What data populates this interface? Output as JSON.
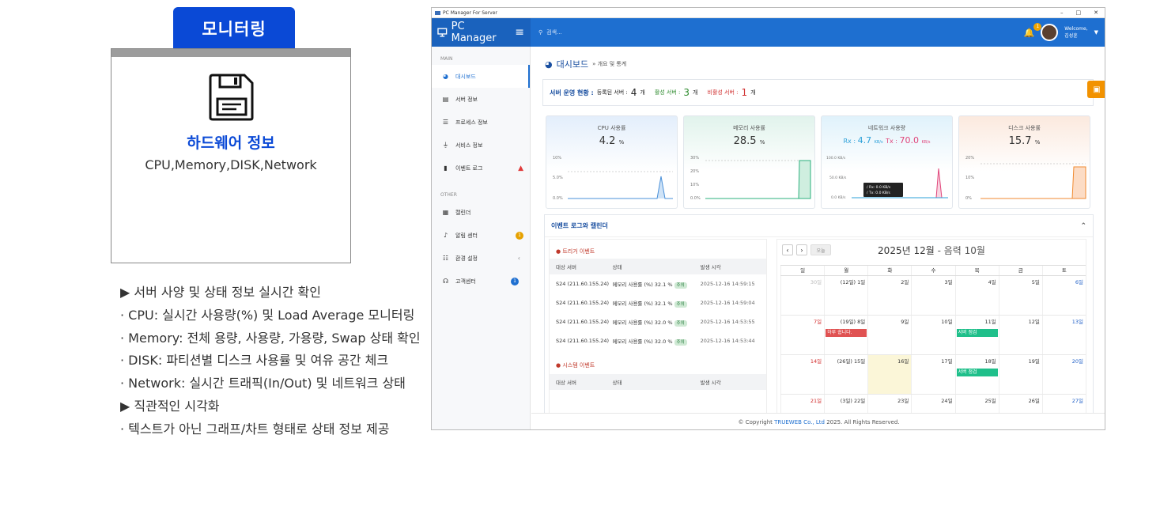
{
  "left": {
    "tab_label": "모니터링",
    "card_title": "하드웨어 정보",
    "card_sub": "CPU,Memory,DISK,Network",
    "desc": [
      "▶ 서버 사양 및 상태 정보 실시간 확인",
      "· CPU: 실시간 사용량(%) 및 Load Average 모니터링",
      "· Memory: 전체 용량, 사용량, 가용량, Swap 상태 확인",
      "· DISK: 파티션별 디스크 사용률 및 여유 공간 체크",
      "· Network: 실시간 트래픽(In/Out) 및 네트워크 상태",
      "▶ 직관적인 시각화",
      "· 텍스트가 아닌 그래프/차트 형태로 상태 정보 제공"
    ]
  },
  "app": {
    "window_title": "PC Manager For Server",
    "brand": "PC Manager",
    "search_placeholder": "검색...",
    "notif_count": "1",
    "welcome": "Welcome,",
    "user": "김성훈",
    "sidebar": {
      "main_label": "MAIN",
      "other_label": "OTHER",
      "main_items": [
        {
          "label": "대시보드",
          "icon": "dashboard-icon"
        },
        {
          "label": "서버 정보",
          "icon": "server-icon"
        },
        {
          "label": "프로세스 정보",
          "icon": "list-icon"
        },
        {
          "label": "서비스 정보",
          "icon": "plug-icon"
        },
        {
          "label": "이벤트 로그",
          "icon": "file-icon"
        }
      ],
      "other_items": [
        {
          "label": "캘린더",
          "icon": "calendar-icon"
        },
        {
          "label": "알림 센터",
          "icon": "bell-icon",
          "badge": "1"
        },
        {
          "label": "환경 설정",
          "icon": "sliders-icon"
        },
        {
          "label": "고객센터",
          "icon": "headset-icon",
          "badge": "1"
        }
      ]
    },
    "breadcrumb": {
      "title": "대시보드",
      "sub": "» 개요 및 통계"
    },
    "status": {
      "title": "서버 운영 현황 :",
      "registered_label": "등록된 서버 :",
      "registered": "4",
      "unit": "개",
      "active_label": "활성 서버 :",
      "active": "3",
      "inactive_label": "비활성 서버 :",
      "inactive": "1"
    },
    "metrics": {
      "cpu": {
        "title": "CPU 사용률",
        "value": "4.2",
        "unit": "%",
        "ticks": [
          "10%",
          "5.0%",
          "0.0%"
        ]
      },
      "memory": {
        "title": "메모리 사용률",
        "value": "28.5",
        "unit": "%",
        "ticks": [
          "30%",
          "20%",
          "10%",
          "0.0%"
        ]
      },
      "network": {
        "title": "네트워크 사용량",
        "rx_label": "Rx : ",
        "rx": "4.7",
        "tx_label": "Tx : ",
        "tx": "70.0",
        "unit": "KB/s",
        "ticks": [
          "100.0 KB/s",
          "50.0 KB/s",
          "0.0 KB/s"
        ],
        "tooltip_rx": "/ Rx: 0.0 KB/s",
        "tooltip_tx": "/ Tx: 0.0 KB/s"
      },
      "disk": {
        "title": "디스크 사용률",
        "value": "15.7",
        "unit": "%",
        "ticks": [
          "20%",
          "10%",
          "0%"
        ]
      }
    },
    "events": {
      "panel_title": "이벤트 로그와 캘린더",
      "trigger_title": "● 트리거 이벤트",
      "system_title": "● 시스템 이벤트",
      "headers": [
        "대상 서버",
        "상태",
        "발생 시각"
      ],
      "rows": [
        {
          "server": "S24 (211.60.155.24)",
          "status": "메모리 사용률 (%) 32.1 %",
          "tag": "주의",
          "time": "2025-12-16 14:59:15"
        },
        {
          "server": "S24 (211.60.155.24)",
          "status": "메모리 사용률 (%) 32.1 %",
          "tag": "주의",
          "time": "2025-12-16 14:59:04"
        },
        {
          "server": "S24 (211.60.155.24)",
          "status": "메모리 사용률 (%) 32.0 %",
          "tag": "주의",
          "time": "2025-12-16 14:53:55"
        },
        {
          "server": "S24 (211.60.155.24)",
          "status": "메모리 사용률 (%) 32.0 %",
          "tag": "주의",
          "time": "2025-12-16 14:53:44"
        }
      ]
    },
    "calendar": {
      "today_btn": "오늘",
      "title": "2025년 12월",
      "lunar": "- 음력 10월",
      "weekdays": [
        "일",
        "월",
        "화",
        "수",
        "목",
        "금",
        "토"
      ],
      "weeks": [
        [
          "30일",
          "(12일) 1일",
          "2일",
          "3일",
          "4일",
          "5일",
          "6일"
        ],
        [
          "7일",
          "(19일) 8일",
          "9일",
          "10일",
          "11일",
          "12일",
          "13일"
        ],
        [
          "14일",
          "(26일) 15일",
          "16일",
          "17일",
          "18일",
          "19일",
          "20일"
        ],
        [
          "21일",
          "(3일) 22일",
          "23일",
          "24일",
          "25일",
          "26일",
          "27일"
        ]
      ],
      "events": {
        "e1": "하루 쉽니다.",
        "e2": "서버 점검",
        "e3": "서버 점검"
      },
      "colors": {
        "red": "#e05252",
        "green": "#1fbf8a"
      }
    },
    "footer": {
      "pre": "© Copyright ",
      "company": "TRUEWEB Co., Ltd",
      "post": " 2025. All Rights Reserved."
    }
  }
}
